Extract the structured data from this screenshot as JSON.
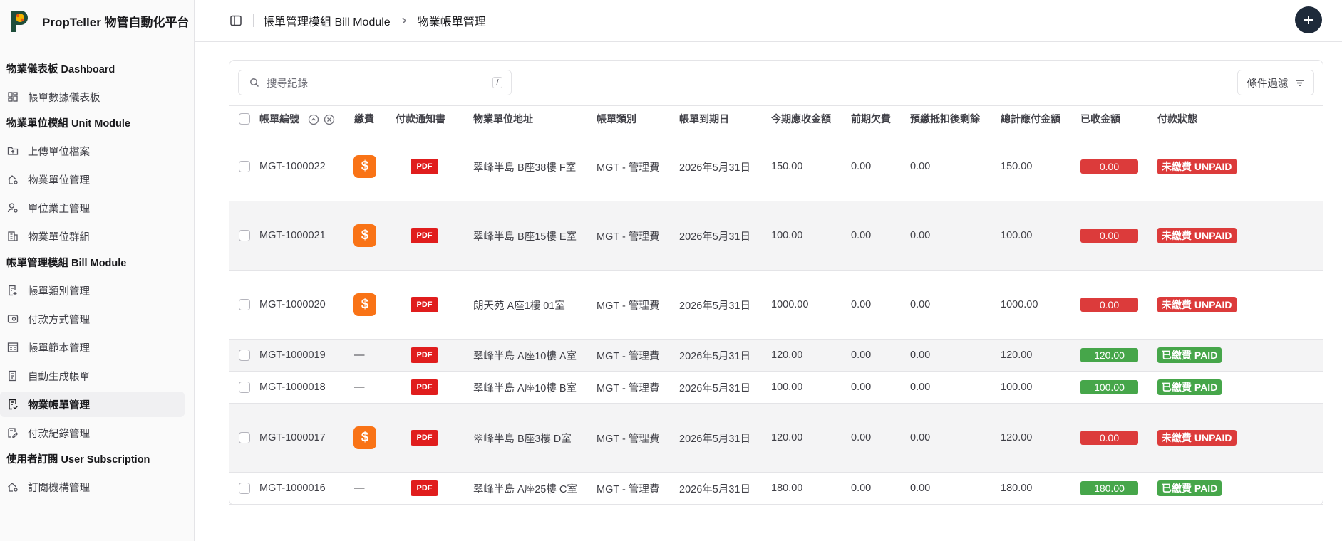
{
  "brand": {
    "name": "PropTeller 物管自動化平台"
  },
  "sidebar": {
    "sections": [
      {
        "title": "物業儀表板 Dashboard",
        "items": [
          {
            "label": "帳單數據儀表板",
            "icon": "dashboard-icon"
          }
        ]
      },
      {
        "title": "物業單位模組 Unit Module",
        "items": [
          {
            "label": "上傳單位檔案",
            "icon": "folder-upload-icon"
          },
          {
            "label": "物業單位管理",
            "icon": "house-gear-icon"
          },
          {
            "label": "單位業主管理",
            "icon": "user-owner-icon"
          },
          {
            "label": "物業單位群組",
            "icon": "building-icon"
          }
        ]
      },
      {
        "title": "帳單管理模組 Bill Module",
        "items": [
          {
            "label": "帳單類別管理",
            "icon": "bill-category-icon"
          },
          {
            "label": "付款方式管理",
            "icon": "wallet-icon"
          },
          {
            "label": "帳單範本管理",
            "icon": "template-icon"
          },
          {
            "label": "自動生成帳單",
            "icon": "auto-bill-icon"
          },
          {
            "label": "物業帳單管理",
            "icon": "bill-check-icon",
            "active": true
          },
          {
            "label": "付款紀錄管理",
            "icon": "payment-record-icon"
          }
        ]
      },
      {
        "title": "使用者訂閱 User Subscription",
        "items": [
          {
            "label": "訂閱機構管理",
            "icon": "house-gear-icon"
          }
        ]
      }
    ]
  },
  "header": {
    "breadcrumb_parent": "帳單管理模組 Bill Module",
    "breadcrumb_current": "物業帳單管理",
    "add_button": "+"
  },
  "toolbar": {
    "search_placeholder": "搜尋紀錄",
    "search_shortcut": "/",
    "filter_label": "條件過濾"
  },
  "table": {
    "columns": [
      "帳單編號",
      "繳費",
      "付款通知書",
      "物業單位地址",
      "帳單類別",
      "帳單到期日",
      "今期應收金額",
      "前期欠費",
      "預繳抵扣後剩餘",
      "總計應付金額",
      "已收金額",
      "付款狀態"
    ],
    "pdf_label": "PDF",
    "pay_symbol": "$",
    "dash": "—",
    "rows": [
      {
        "id": "MGT-1000022",
        "payable": true,
        "address": "翠峰半島 B座38樓 F室",
        "category": "MGT - 管理費",
        "due": "2026年5月31日",
        "current": "150.00",
        "arrears": "0.00",
        "remaining": "0.00",
        "total": "150.00",
        "received": "0.00",
        "status": "未繳費 UNPAID",
        "paid": false
      },
      {
        "id": "MGT-1000021",
        "payable": true,
        "address": "翠峰半島 B座15樓 E室",
        "category": "MGT - 管理費",
        "due": "2026年5月31日",
        "current": "100.00",
        "arrears": "0.00",
        "remaining": "0.00",
        "total": "100.00",
        "received": "0.00",
        "status": "未繳費 UNPAID",
        "paid": false
      },
      {
        "id": "MGT-1000020",
        "payable": true,
        "address": "朗天苑 A座1樓 01室",
        "category": "MGT - 管理費",
        "due": "2026年5月31日",
        "current": "1000.00",
        "arrears": "0.00",
        "remaining": "0.00",
        "total": "1000.00",
        "received": "0.00",
        "status": "未繳費 UNPAID",
        "paid": false
      },
      {
        "id": "MGT-1000019",
        "payable": false,
        "address": "翠峰半島 A座10樓 A室",
        "category": "MGT - 管理費",
        "due": "2026年5月31日",
        "current": "120.00",
        "arrears": "0.00",
        "remaining": "0.00",
        "total": "120.00",
        "received": "120.00",
        "status": "已繳費 PAID",
        "paid": true
      },
      {
        "id": "MGT-1000018",
        "payable": false,
        "address": "翠峰半島 A座10樓 B室",
        "category": "MGT - 管理費",
        "due": "2026年5月31日",
        "current": "100.00",
        "arrears": "0.00",
        "remaining": "0.00",
        "total": "100.00",
        "received": "100.00",
        "status": "已繳費 PAID",
        "paid": true
      },
      {
        "id": "MGT-1000017",
        "payable": true,
        "address": "翠峰半島 B座3樓 D室",
        "category": "MGT - 管理費",
        "due": "2026年5月31日",
        "current": "120.00",
        "arrears": "0.00",
        "remaining": "0.00",
        "total": "120.00",
        "received": "0.00",
        "status": "未繳費 UNPAID",
        "paid": false
      },
      {
        "id": "MGT-1000016",
        "payable": false,
        "address": "翠峰半島 A座25樓 C室",
        "category": "MGT - 管理費",
        "due": "2026年5月31日",
        "current": "180.00",
        "arrears": "0.00",
        "remaining": "0.00",
        "total": "180.00",
        "received": "180.00",
        "status": "已繳費 PAID",
        "paid": true
      }
    ]
  },
  "colors": {
    "accent_orange": "#f97316",
    "pdf_red": "#e01d1d",
    "unpaid_red": "#dc3b3b",
    "paid_green": "#46a64a",
    "fab_navy": "#1e2a3a"
  }
}
